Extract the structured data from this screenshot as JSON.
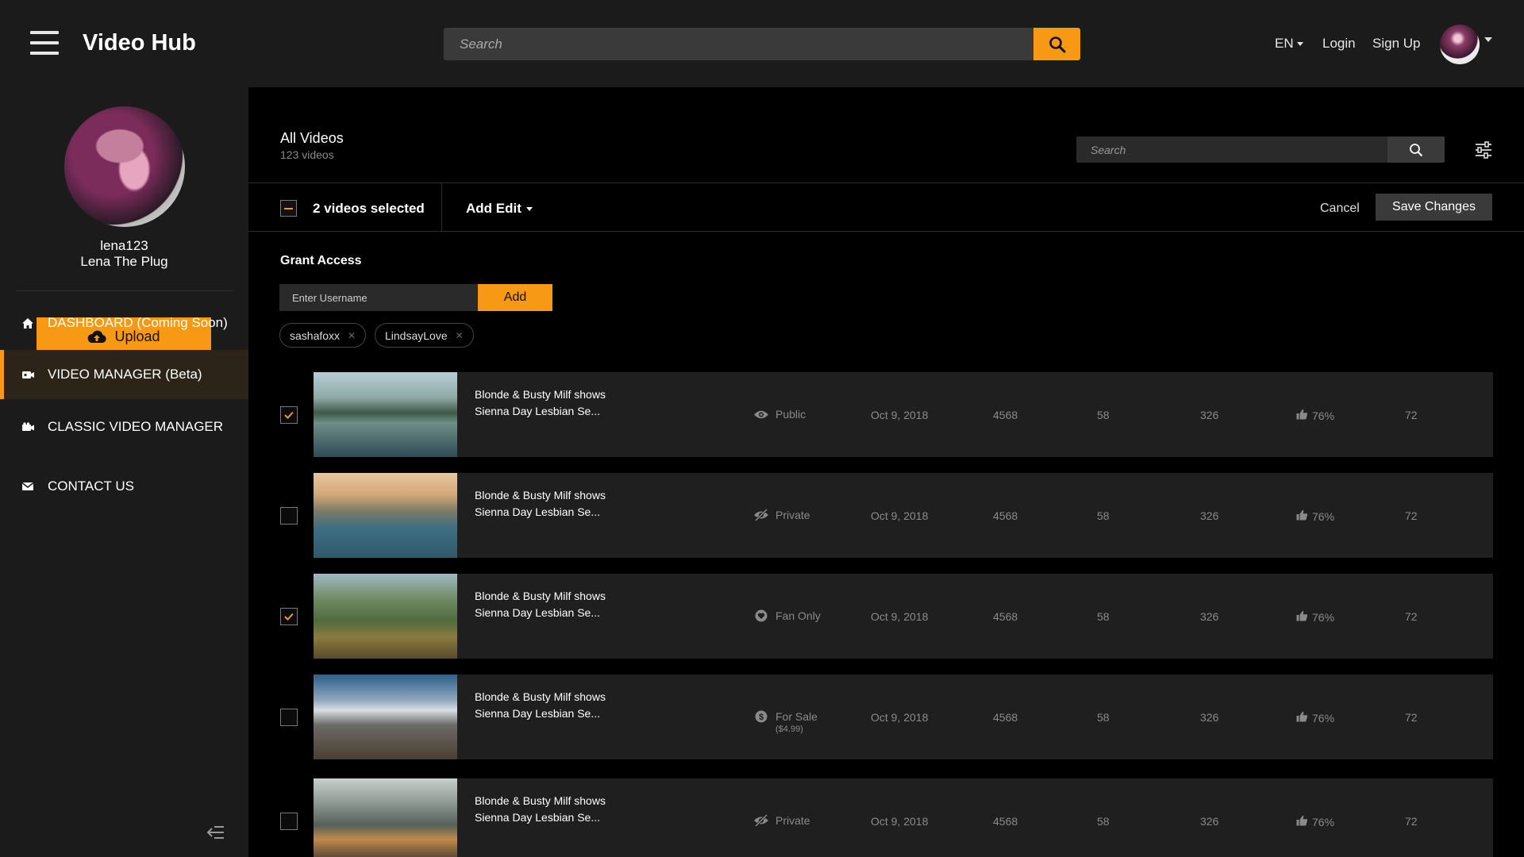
{
  "header": {
    "app_title": "Video Hub",
    "search_placeholder": "Search",
    "language": "EN",
    "login_label": "Login",
    "signup_label": "Sign Up",
    "accent_color": "#f79914"
  },
  "sidebar": {
    "username": "lena123",
    "display_name": "Lena The Plug",
    "upload_label": "Upload",
    "items": [
      {
        "label": "DASHBOARD (Coming Soon)",
        "icon": "home-icon"
      },
      {
        "label": "VIDEO MANAGER (Beta)",
        "icon": "video-manager-icon",
        "active": true
      },
      {
        "label": "CLASSIC VIDEO MANAGER",
        "icon": "camera-icon"
      },
      {
        "label": "CONTACT US",
        "icon": "envelope-icon"
      }
    ]
  },
  "main": {
    "title": "All Videos",
    "count": "123 videos",
    "search_placeholder": "Search",
    "selection_text": "2 videos selected",
    "add_edit_label": "Add Edit",
    "cancel_label": "Cancel",
    "save_label": "Save Changes",
    "grant_access": {
      "title": "Grant Access",
      "input_placeholder": "Enter Username",
      "add_label": "Add",
      "chips": [
        "sashafoxx",
        "LindsayLove"
      ]
    },
    "videos": [
      {
        "checked": true,
        "title_line1": "Blonde & Busty Milf shows",
        "title_line2": "Sienna Day Lesbian Se...",
        "status": "Public",
        "status_icon": "eye-icon",
        "price": "",
        "date": "Oct 9, 2018",
        "views": "4568",
        "col2": "58",
        "col3": "326",
        "rating": "76%",
        "col5": "72"
      },
      {
        "checked": false,
        "title_line1": "Blonde & Busty Milf shows",
        "title_line2": "Sienna Day Lesbian Se...",
        "status": "Private",
        "status_icon": "eye-slash-icon",
        "price": "",
        "date": "Oct 9, 2018",
        "views": "4568",
        "col2": "58",
        "col3": "326",
        "rating": "76%",
        "col5": "72"
      },
      {
        "checked": true,
        "title_line1": "Blonde & Busty Milf shows",
        "title_line2": "Sienna Day Lesbian Se...",
        "status": "Fan Only",
        "status_icon": "heart-icon",
        "price": "",
        "date": "Oct 9, 2018",
        "views": "4568",
        "col2": "58",
        "col3": "326",
        "rating": "76%",
        "col5": "72"
      },
      {
        "checked": false,
        "title_line1": "Blonde & Busty Milf shows",
        "title_line2": "Sienna Day Lesbian Se...",
        "status": "For Sale",
        "status_icon": "dollar-icon",
        "price": "($4.99)",
        "date": "Oct 9, 2018",
        "views": "4568",
        "col2": "58",
        "col3": "326",
        "rating": "76%",
        "col5": "72"
      },
      {
        "checked": false,
        "title_line1": "Blonde & Busty Milf shows",
        "title_line2": "Sienna Day Lesbian Se...",
        "status": "Private",
        "status_icon": "eye-slash-icon",
        "price": "",
        "date": "Oct 9, 2018",
        "views": "4568",
        "col2": "58",
        "col3": "326",
        "rating": "76%",
        "col5": "72"
      }
    ]
  }
}
